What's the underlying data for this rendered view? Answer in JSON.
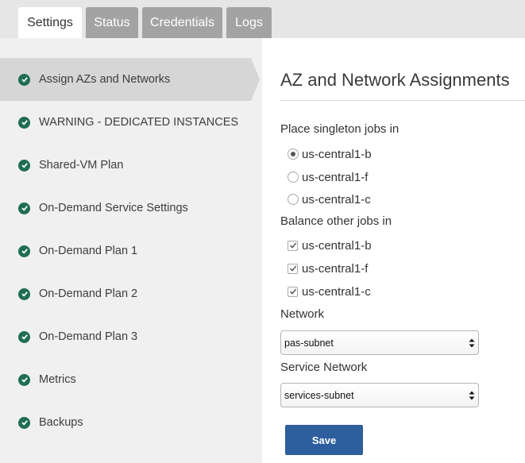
{
  "tabs": [
    {
      "label": "Settings",
      "active": true
    },
    {
      "label": "Status",
      "active": false
    },
    {
      "label": "Credentials",
      "active": false
    },
    {
      "label": "Logs",
      "active": false
    }
  ],
  "sidebar": {
    "items": [
      {
        "label": "Assign AZs and Networks",
        "active": true,
        "status": "check-circle-icon"
      },
      {
        "label": "WARNING - DEDICATED INSTANCES",
        "status": "check-circle-icon"
      },
      {
        "label": "Shared-VM Plan",
        "status": "check-circle-icon"
      },
      {
        "label": "On-Demand Service Settings",
        "status": "check-circle-icon"
      },
      {
        "label": "On-Demand Plan 1",
        "status": "check-circle-icon"
      },
      {
        "label": "On-Demand Plan 2",
        "status": "check-circle-icon"
      },
      {
        "label": "On-Demand Plan 3",
        "status": "check-circle-icon"
      },
      {
        "label": "Metrics",
        "status": "check-circle-icon"
      },
      {
        "label": "Backups",
        "status": "check-circle-icon"
      }
    ]
  },
  "main": {
    "title": "AZ and Network Assignments",
    "singleton": {
      "label": "Place singleton jobs in",
      "options": [
        {
          "label": "us-central1-b",
          "selected": true
        },
        {
          "label": "us-central1-f",
          "selected": false
        },
        {
          "label": "us-central1-c",
          "selected": false
        }
      ]
    },
    "balance": {
      "label": "Balance other jobs in",
      "options": [
        {
          "label": "us-central1-b",
          "checked": true
        },
        {
          "label": "us-central1-f",
          "checked": true
        },
        {
          "label": "us-central1-c",
          "checked": true
        }
      ]
    },
    "network": {
      "label": "Network",
      "value": "pas-subnet"
    },
    "service_network": {
      "label": "Service Network",
      "value": "services-subnet"
    },
    "save_label": "Save"
  },
  "colors": {
    "accent": "#2d5e9e",
    "check": "#1f6d55",
    "tab_inactive": "#a3a3a3"
  }
}
